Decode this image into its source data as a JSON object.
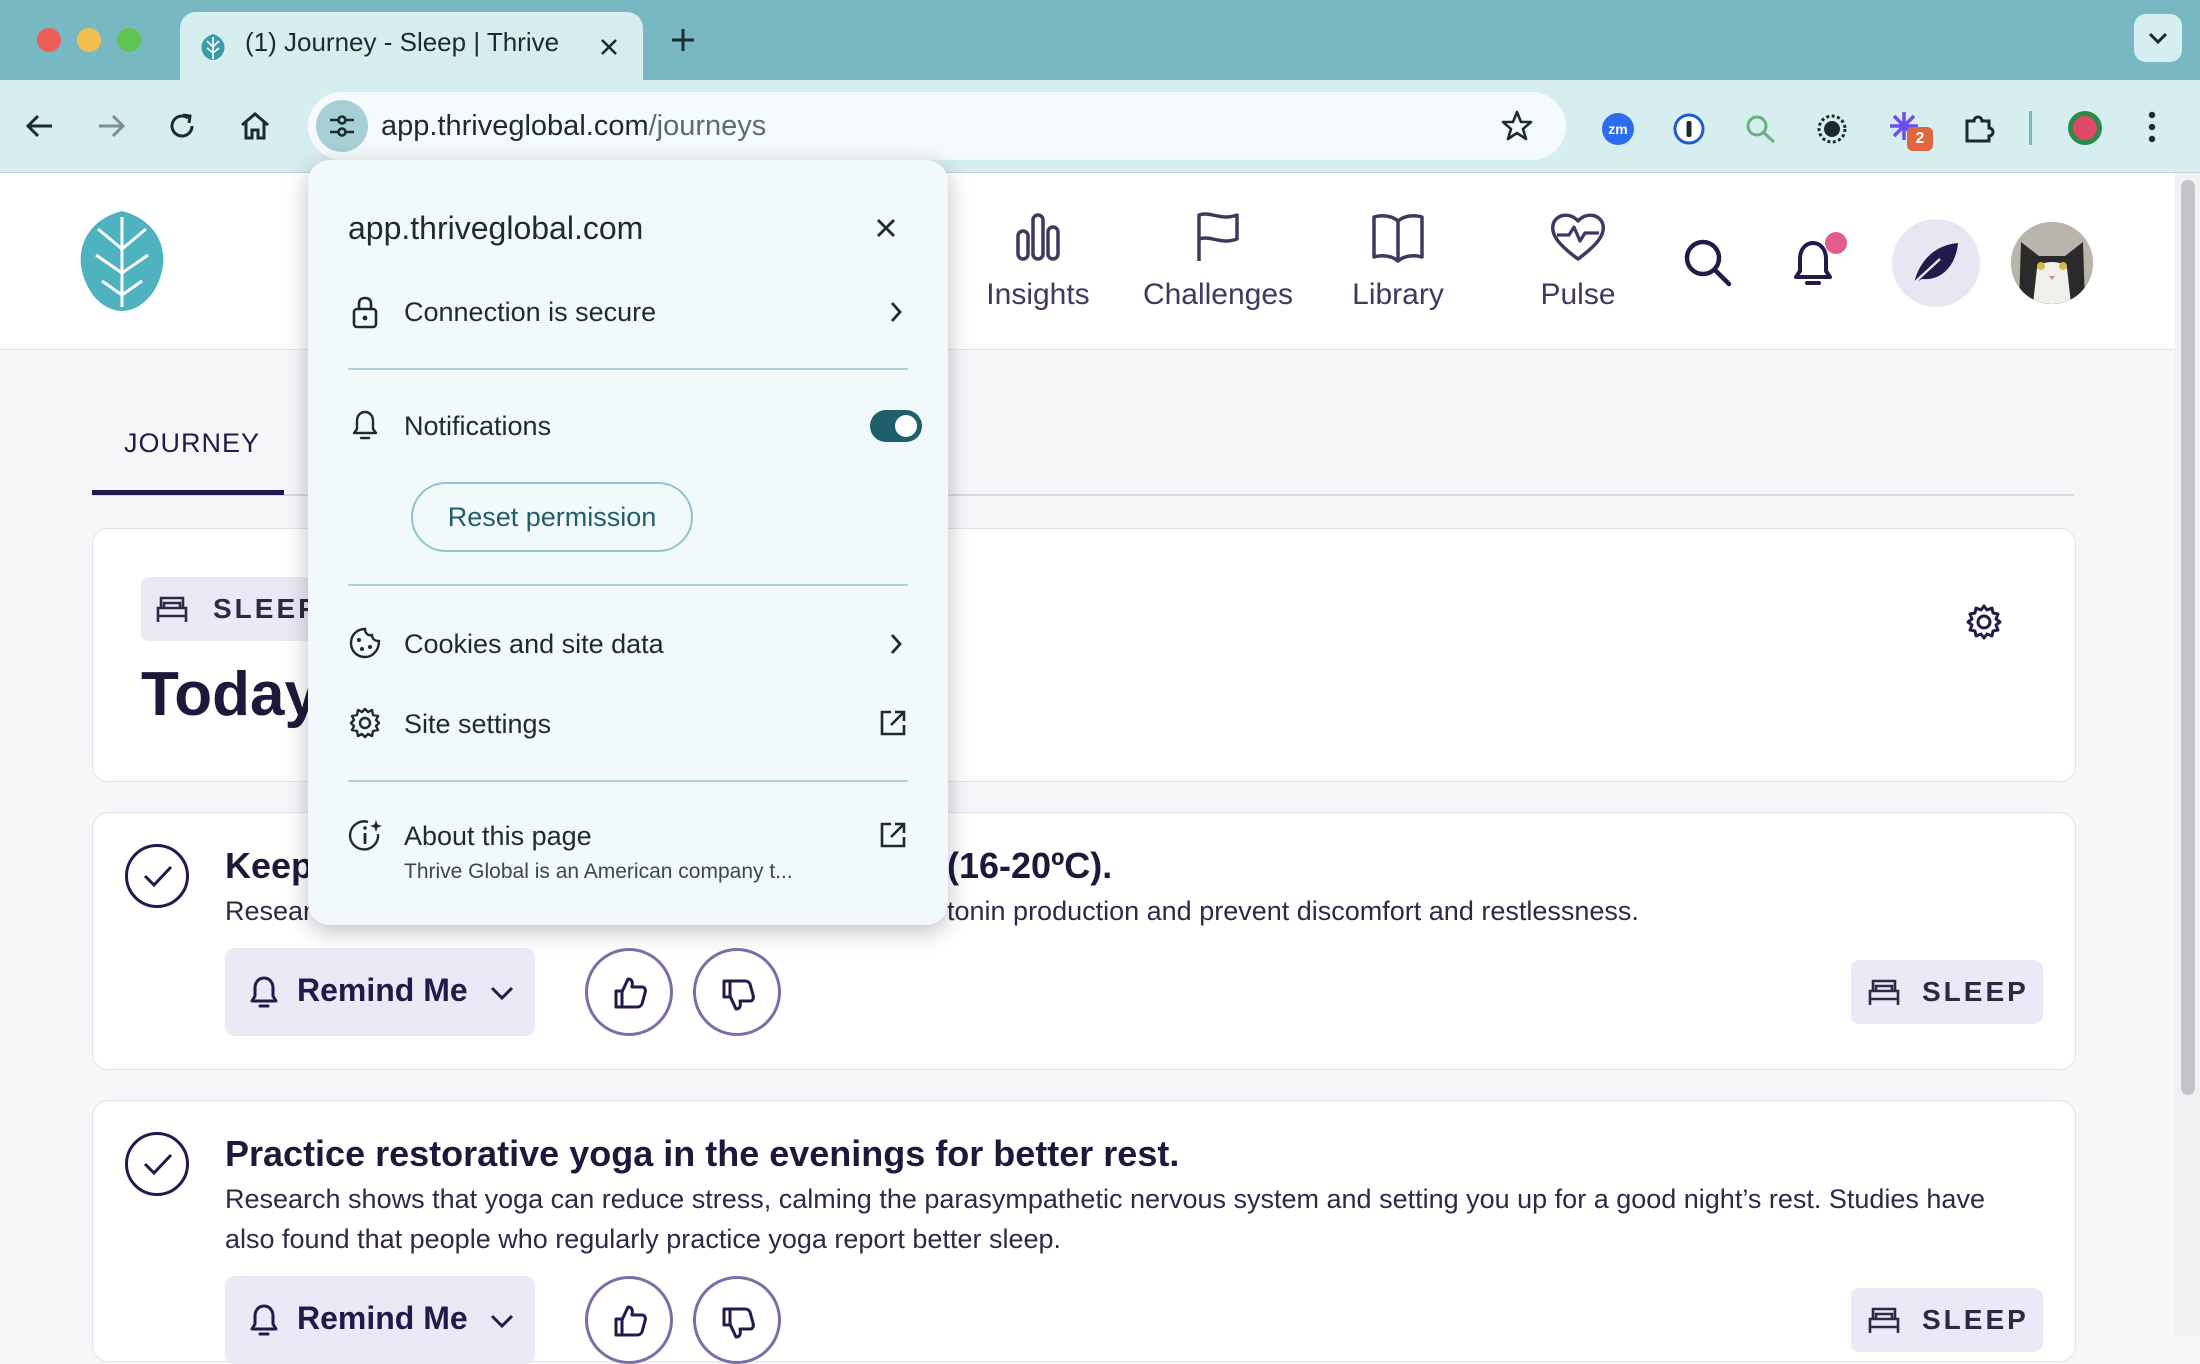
{
  "browser": {
    "tab_title": "(1) Journey - Sleep | Thrive",
    "url_host": "app.thriveglobal.com",
    "url_path": "/journeys",
    "extension_badge": "2",
    "zoom_ext_label": "zm"
  },
  "site_popup": {
    "host": "app.thriveglobal.com",
    "connection": "Connection is secure",
    "notifications": "Notifications",
    "notifications_on": true,
    "reset_permission": "Reset permission",
    "cookies": "Cookies and site data",
    "site_settings": "Site settings",
    "about": "About this page",
    "about_desc": "Thrive Global is an American company t..."
  },
  "nav": {
    "items": [
      {
        "label": "Insights",
        "icon": "bar-chart-icon"
      },
      {
        "label": "Challenges",
        "icon": "flag-icon"
      },
      {
        "label": "Library",
        "icon": "book-icon"
      },
      {
        "label": "Pulse",
        "icon": "heart-pulse-icon"
      }
    ]
  },
  "page": {
    "tab_journey": "JOURNEY",
    "sleep_badge": "SLEEP",
    "today_heading": "Today"
  },
  "tips": [
    {
      "title_left": "Keep",
      "title_right": "(16-20ºC).",
      "desc_left": "Researc",
      "desc_right": "tonin production and prevent discomfort and restlessness.",
      "remind": "Remind Me",
      "tag": "SLEEP"
    },
    {
      "title": "Practice restorative yoga in the evenings for better rest.",
      "desc": "Research shows that yoga can reduce stress, calming the parasympathetic nervous system and setting you up for a good night’s rest. Studies have also found that people who regularly practice yoga report better sleep.",
      "remind": "Remind Me",
      "tag": "SLEEP"
    }
  ],
  "colors": {
    "tabstrip": "#78b8c2",
    "toolbar": "#d7eef1",
    "brand_navy": "#211a4a",
    "tag_bg": "#ece9f6",
    "toggle": "#1f5f6b",
    "notification_dot": "#e45b8c"
  }
}
